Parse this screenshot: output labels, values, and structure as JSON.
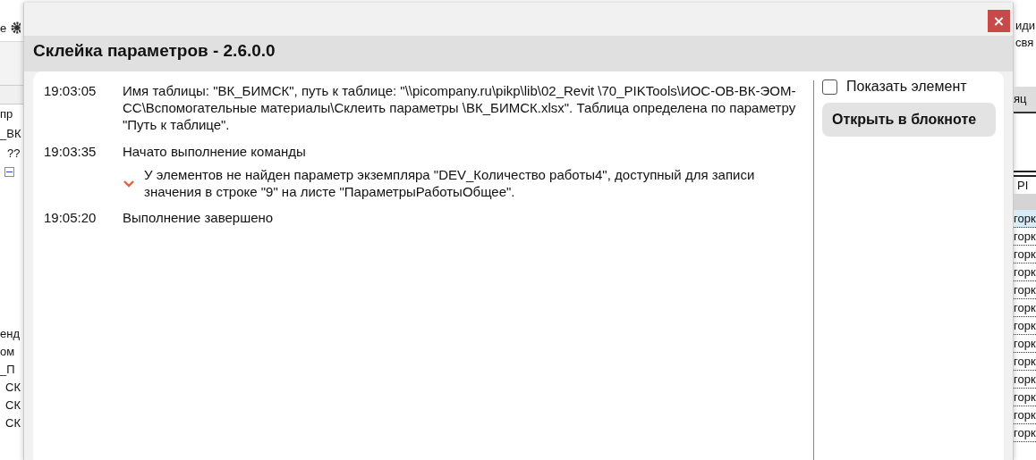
{
  "background": {
    "left_top": "е",
    "left_items": [
      {
        "kind": "text",
        "text": "пр"
      },
      {
        "kind": "text",
        "text": "_ВК"
      },
      {
        "kind": "tree",
        "text": "??"
      },
      {
        "kind": "toggle",
        "expanded": true
      }
    ],
    "left_lower": [
      "енд",
      "ом",
      "_П",
      "СК",
      "СК",
      "СК"
    ],
    "right_top": [
      "иди",
      "свя"
    ],
    "right_tab": "яц",
    "right_header": "PI",
    "right_rows": [
      {
        "text": "горк",
        "selected": true
      },
      {
        "text": "горк",
        "selected": false
      },
      {
        "text": "горк",
        "selected": false
      },
      {
        "text": "горк",
        "selected": false
      },
      {
        "text": "горк",
        "selected": false
      },
      {
        "text": "горк",
        "selected": false
      },
      {
        "text": "горк",
        "selected": false
      },
      {
        "text": "горк",
        "selected": false
      },
      {
        "text": "горк",
        "selected": false
      },
      {
        "text": "горк",
        "selected": false
      },
      {
        "text": "горк",
        "selected": false
      },
      {
        "text": "горк",
        "selected": false
      },
      {
        "text": "горк",
        "selected": false
      }
    ]
  },
  "window": {
    "title": "Склейка параметров - 2.6.0.0",
    "close": "×"
  },
  "log": [
    {
      "kind": "entry",
      "time": "19:03:05",
      "text": "Имя таблицы: \"ВК_БИМСК\", путь к таблице: \"\\\\picompany.ru\\pikp\\lib\\02_Revit \\70_PIKTools\\ИОС-ОВ-ВК-ЭОМ-СС\\Вспомогательные материалы\\Склеить параметры \\ВК_БИМСК.xlsx\". Таблица определена по параметру \"Путь к таблице\"."
    },
    {
      "kind": "entry",
      "time": "19:03:35",
      "text": "Начато выполнение команды"
    },
    {
      "kind": "warning",
      "text": "У элементов не найден параметр экземпляра \"DEV_Количество работы4\", доступный для записи значения в строке \"9\" на листе \"ПараметрыРаботыОбщее\"."
    },
    {
      "kind": "entry",
      "time": "19:05:20",
      "text": "Выполнение завершено"
    }
  ],
  "side": {
    "checkbox": {
      "label": "Показать элемент",
      "checked": false
    },
    "button": "Открыть в блокноте"
  }
}
